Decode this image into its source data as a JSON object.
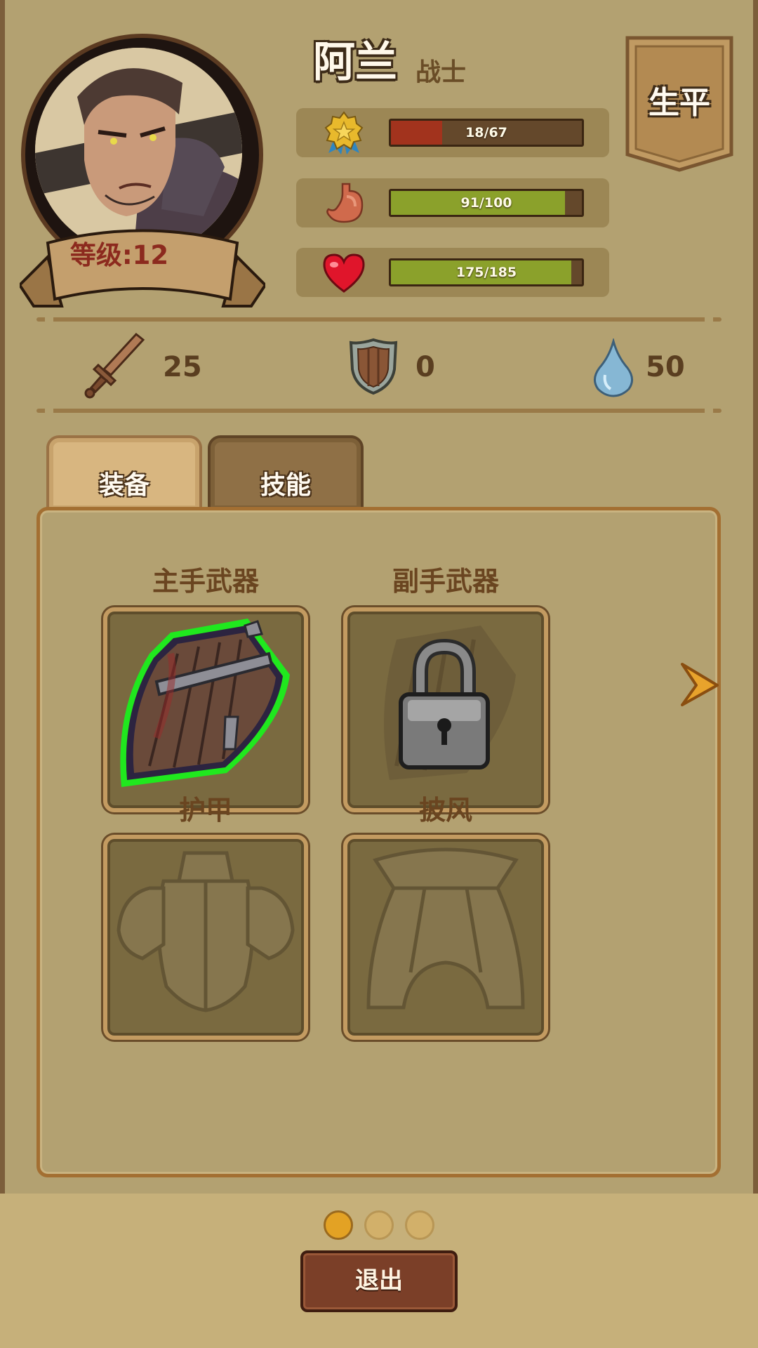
{
  "character": {
    "name": "阿兰",
    "class": "战士",
    "level_label": "等级:12"
  },
  "stats": [
    {
      "icon": "medal-icon",
      "value_text": "18/67",
      "fill": 0.27,
      "color": "#a2331d"
    },
    {
      "icon": "stomach-icon",
      "value_text": "91/100",
      "fill": 0.91,
      "color": "#8ba12b"
    },
    {
      "icon": "heart-icon",
      "value_text": "175/185",
      "fill": 0.946,
      "color": "#8ba12b"
    }
  ],
  "biography_label": "生平",
  "attributes": {
    "attack": {
      "icon": "sword-icon",
      "value": "25"
    },
    "defense": {
      "icon": "shield-icon",
      "value": "0"
    },
    "mana": {
      "icon": "water-drop-icon",
      "value": "50"
    }
  },
  "tabs": [
    {
      "label": "装备",
      "active": true
    },
    {
      "label": "技能",
      "active": false
    }
  ],
  "slots": [
    {
      "label": "主手武器",
      "state": "equipped",
      "icon": "wooden-shield-icon"
    },
    {
      "label": "副手武器",
      "state": "locked",
      "icon": "lock-icon"
    },
    {
      "label": "护甲",
      "state": "empty",
      "icon": "armor-icon"
    },
    {
      "label": "披风",
      "state": "empty",
      "icon": "cloak-icon"
    }
  ],
  "pagination": {
    "current": 1,
    "total": 3
  },
  "exit_label": "退出",
  "colors": {
    "background": "#b3a171",
    "panel_border": "#a36f32",
    "exp_bar": "#a2331d",
    "status_bar": "#8ba12b",
    "exit_button": "#7b3f28"
  }
}
